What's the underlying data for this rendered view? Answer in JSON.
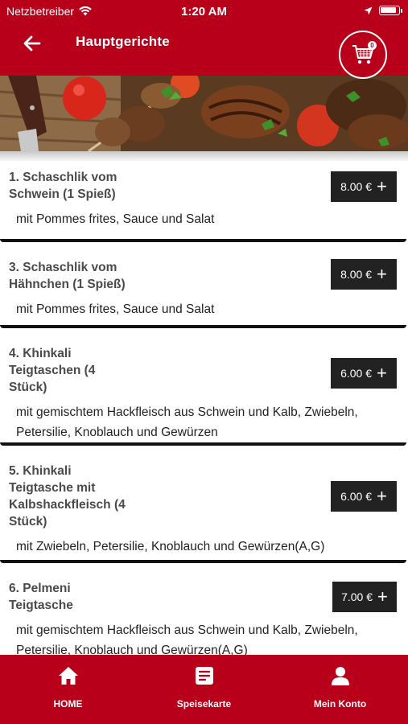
{
  "status_bar": {
    "carrier": "Netzbetreiber",
    "time": "1:20 AM",
    "battery_level": 0.9
  },
  "header": {
    "title": "Hauptgerichte",
    "back_icon": "arrow-left-icon",
    "cart_icon": "shopping-cart-icon",
    "cart_count": "0"
  },
  "menu": {
    "items": [
      {
        "name": "1. Schaschlik vom Schwein (1 Spieß)",
        "description": "mit Pommes frites, Sauce und Salat",
        "price": "8.00 €"
      },
      {
        "name": "3. Schaschlik vom Hähnchen (1 Spieß)",
        "description": "mit Pommes frites, Sauce und Salat",
        "price": "8.00 €"
      },
      {
        "name": "4. Khinkali Teigtaschen (4 Stück)",
        "description": "mit gemischtem Hackfleisch aus Schwein und Kalb, Zwiebeln, Petersilie, Knoblauch und Gewürzen",
        "price": "6.00 €"
      },
      {
        "name": "5. Khinkali Teigtasche mit Kalbshackfleisch (4 Stück)",
        "description": "mit Zwiebeln, Petersilie, Knoblauch und Gewürzen(A,G)",
        "price": "6.00 €"
      },
      {
        "name": "6. Pelmeni Teigtasche",
        "description": "mit gemischtem Hackfleisch aus Schwein und Kalb, Zwiebeln, Petersilie, Knoblauch und Gewürzen(A,G)",
        "price": "7.00 €"
      }
    ]
  },
  "bottom_nav": {
    "home": {
      "label": "HOME",
      "icon": "home-icon"
    },
    "menu": {
      "label": "Speisekarte",
      "icon": "document-icon"
    },
    "account": {
      "label": "Mein Konto",
      "icon": "user-icon"
    }
  },
  "colors": {
    "brand": "#b8001a",
    "price_button": "#222222"
  }
}
